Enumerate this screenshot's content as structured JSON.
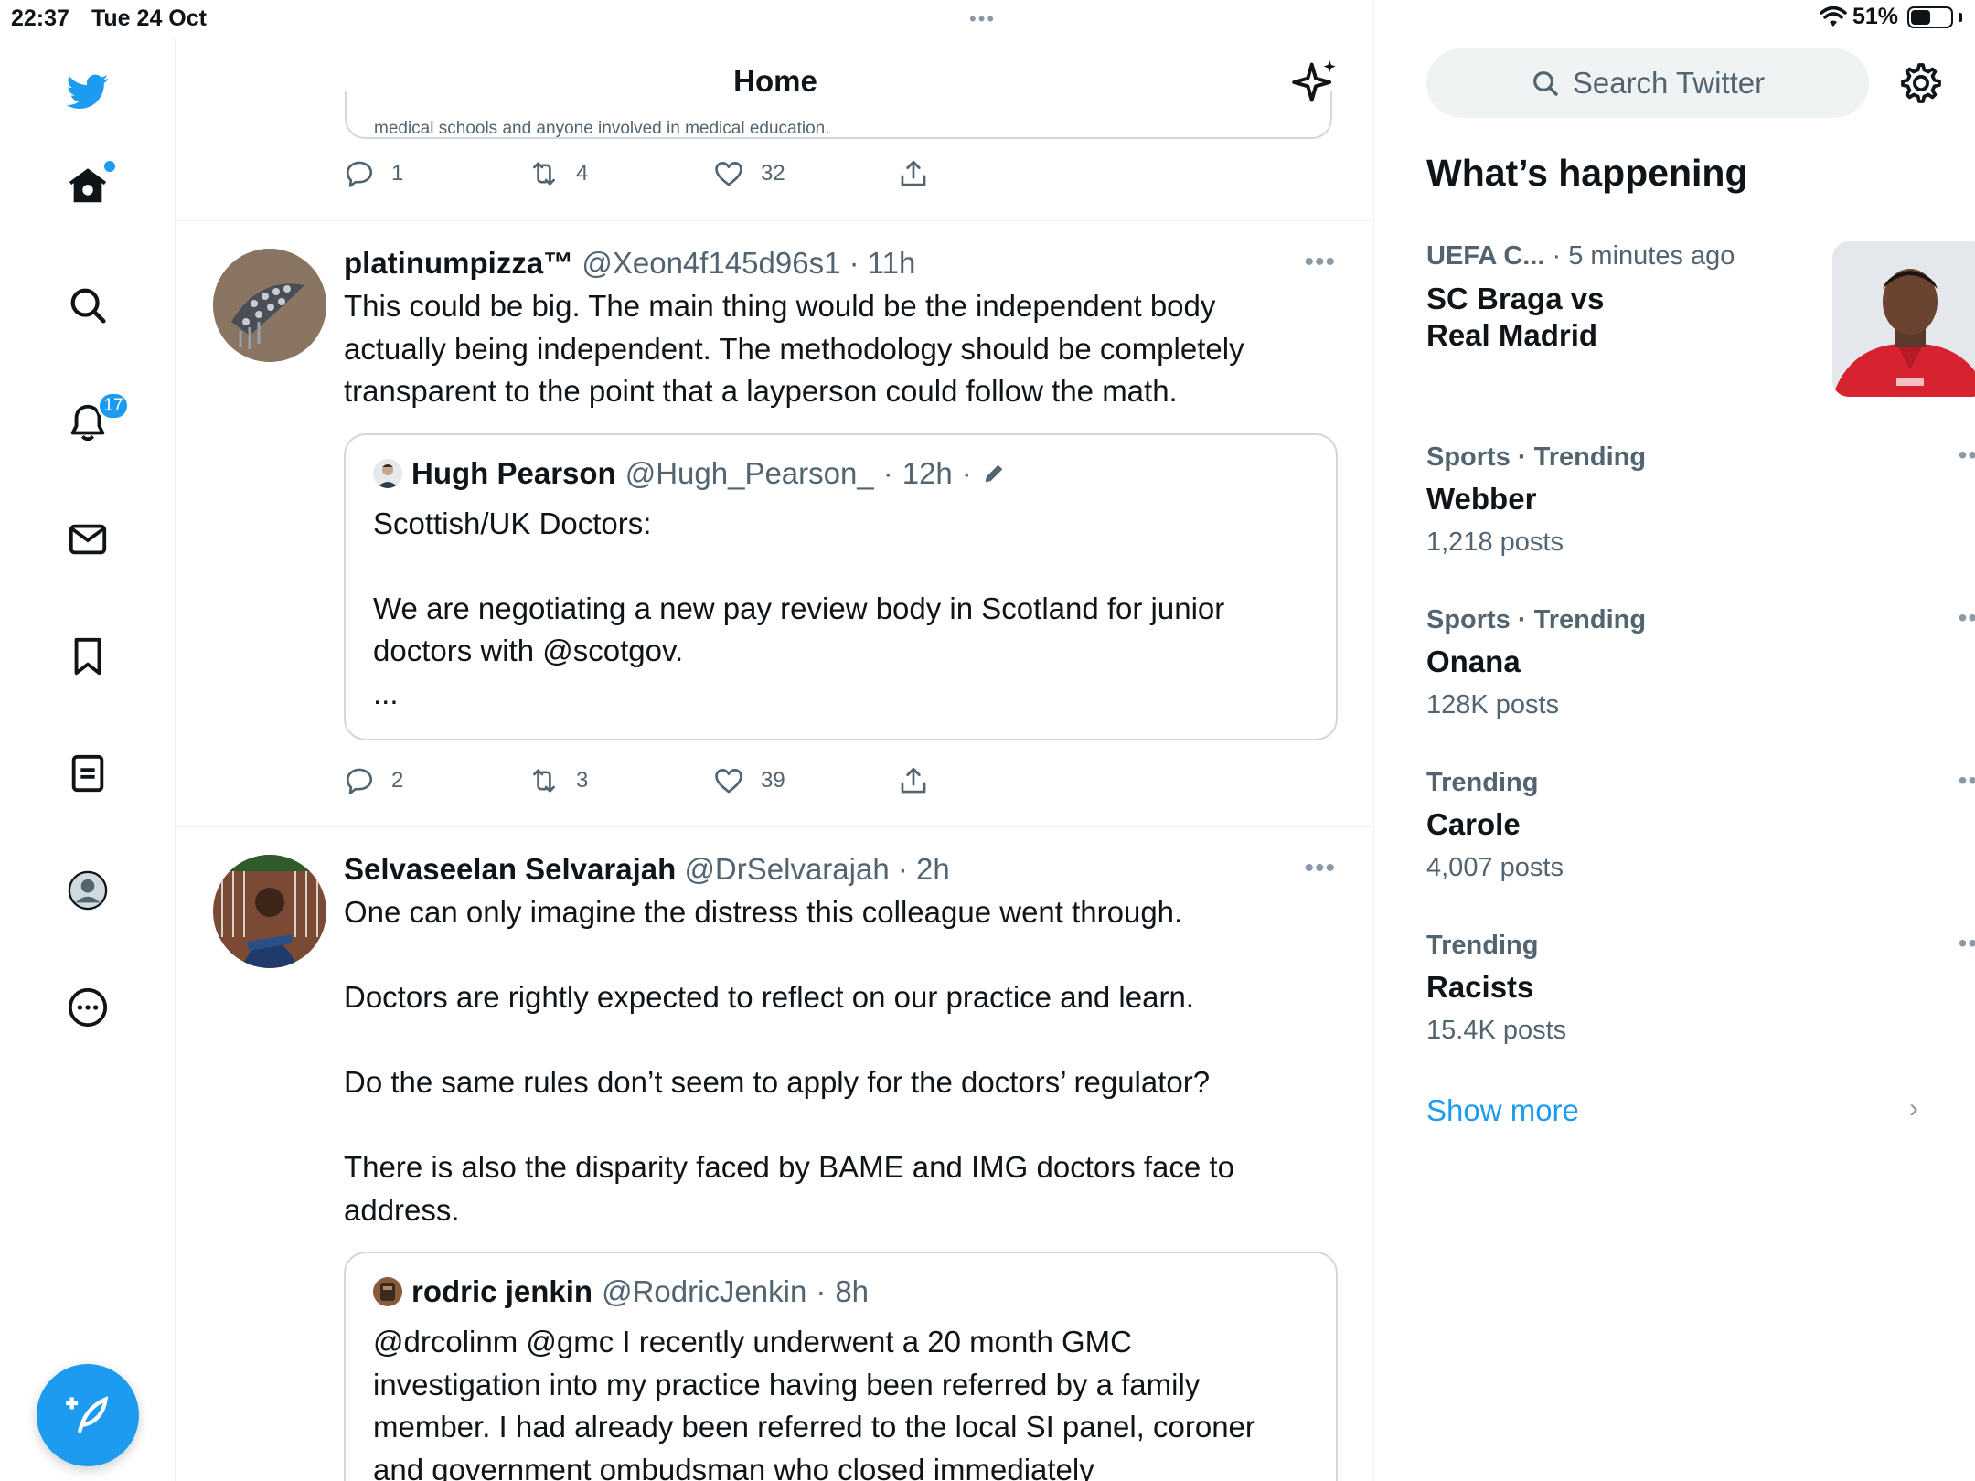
{
  "status": {
    "time": "22:37",
    "date": "Tue 24 Oct",
    "battery": "51%",
    "battery_level": 0.51,
    "multitask": "•••"
  },
  "nav": {
    "notifications_badge": "17"
  },
  "header": {
    "title": "Home"
  },
  "prev_tweet": {
    "quote_fragment": "medical schools and anyone involved in medical education.",
    "replies": "1",
    "retweets": "4",
    "likes": "32"
  },
  "tweets": [
    {
      "name": "platinumpizza™",
      "handle": "@Xeon4f145d96s1",
      "time": "11h",
      "text": "This could be big. The main thing would be the independent body\nactually being independent. The methodology should be completely\ntransparent to the point that a layperson could follow the math.",
      "quote": {
        "name": "Hugh Pearson",
        "handle": "@Hugh_Pearson_",
        "time": "12h",
        "text": "Scottish/UK Doctors:\n\nWe are negotiating a new pay review body in Scotland for junior\ndoctors with @scotgov.\n..."
      },
      "replies": "2",
      "retweets": "3",
      "likes": "39"
    },
    {
      "name": "Selvaseelan Selvarajah",
      "handle": "@DrSelvarajah",
      "time": "2h",
      "text": "One can only imagine the distress this colleague went through.\n\nDoctors are rightly expected to reflect on our practice and learn.\n\nDo the same rules don’t seem to apply for the doctors’ regulator?\n\nThere is also the disparity faced by BAME and IMG doctors face to\naddress.",
      "quote": {
        "name": "rodric jenkin",
        "handle": "@RodricJenkin",
        "time": "8h",
        "text": "@drcolinm @gmc I recently underwent a 20 month GMC\ninvestigation into my practice having been referred by a family\nmember. I had already been referred to the local SI panel, coroner\nand government ombudsman who closed immediately"
      }
    }
  ],
  "sidebar": {
    "search_placeholder": "Search Twitter",
    "whats_happening": "What’s happening",
    "featured": {
      "category": "UEFA C...",
      "time": "· 5 minutes ago",
      "title": "SC Braga vs\nReal Madrid"
    },
    "trends": [
      {
        "category": "Sports · Trending",
        "name": "Webber",
        "count": "1,218 posts"
      },
      {
        "category": "Sports · Trending",
        "name": "Onana",
        "count": "128K posts"
      },
      {
        "category": "Trending",
        "name": "Carole",
        "count": "4,007 posts"
      },
      {
        "category": "Trending",
        "name": "Racists",
        "count": "15.4K posts"
      }
    ],
    "show_more": "Show more"
  }
}
